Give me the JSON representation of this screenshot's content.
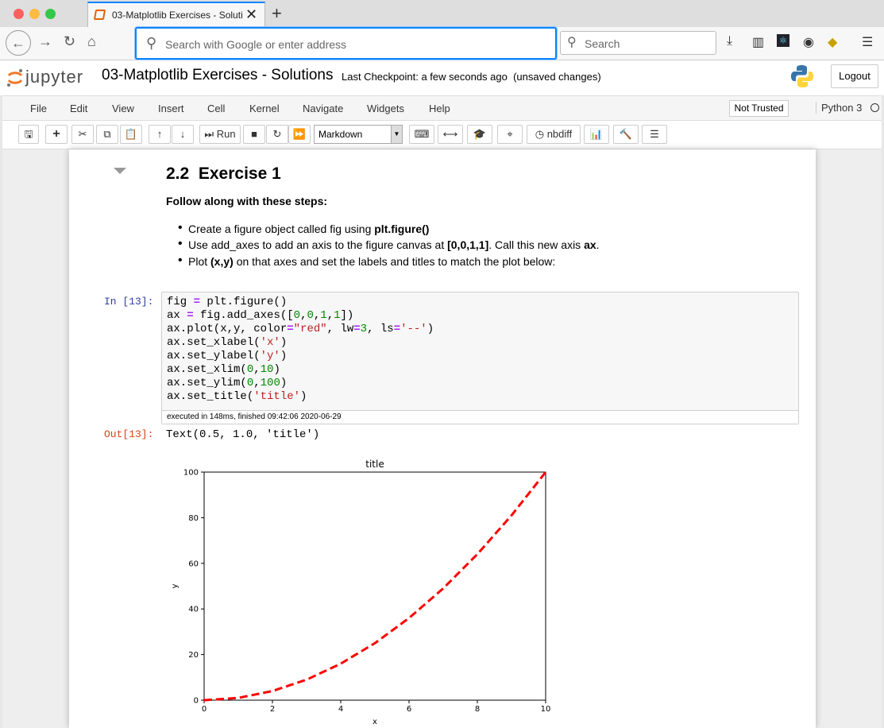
{
  "browser": {
    "tab_title": "03-Matplotlib Exercises - Soluti",
    "url_placeholder": "Search with Google or enter address",
    "search_placeholder": "Search"
  },
  "header": {
    "logo_text": "jupyter",
    "notebook_name": "03-Matplotlib Exercises - Solutions",
    "checkpoint": "Last Checkpoint: a few seconds ago  (unsaved changes)",
    "logout_label": "Logout"
  },
  "menu": {
    "items": [
      "File",
      "Edit",
      "View",
      "Insert",
      "Cell",
      "Kernel",
      "Navigate",
      "Widgets",
      "Help"
    ],
    "trust_label": "Not Trusted",
    "kernel_name": "Python 3"
  },
  "toolbar": {
    "run_label": "Run",
    "cell_type": "Markdown",
    "nbdiff_label": "nbdiff"
  },
  "markdown": {
    "heading": "2.2  Exercise 1",
    "intro": "Follow along with these steps:",
    "bullets": [
      [
        "Create a figure object called fig using ",
        "plt.figure()",
        "",
        "",
        ""
      ],
      [
        "Use add_axes to add an axis to the figure canvas at ",
        "[0,0,1,1]",
        ". Call this new axis ",
        "ax",
        "."
      ],
      [
        "Plot ",
        "(x,y)",
        " on that axes and set the labels and titles to match the plot below:",
        "",
        ""
      ]
    ]
  },
  "cell": {
    "in_prompt": "In [13]:",
    "out_prompt": "Out[13]:",
    "exec_info": "executed in 148ms, finished 09:42:06 2020-06-29",
    "output_text": "Text(0.5, 1.0, 'title')"
  },
  "chart_data": {
    "type": "line",
    "title": "title",
    "xlabel": "x",
    "ylabel": "y",
    "xlim": [
      0,
      10
    ],
    "ylim": [
      0,
      100
    ],
    "x_ticks": [
      0,
      2,
      4,
      6,
      8,
      10
    ],
    "y_ticks": [
      0,
      20,
      40,
      60,
      80,
      100
    ],
    "grid": false,
    "series": [
      {
        "color": "#ff0000",
        "linestyle": "dashed",
        "x": [
          0,
          1,
          2,
          3,
          4,
          5,
          6,
          7,
          8,
          9,
          10
        ],
        "y": [
          0,
          1,
          4,
          9,
          16,
          25,
          36,
          49,
          64,
          81,
          100
        ]
      }
    ]
  }
}
